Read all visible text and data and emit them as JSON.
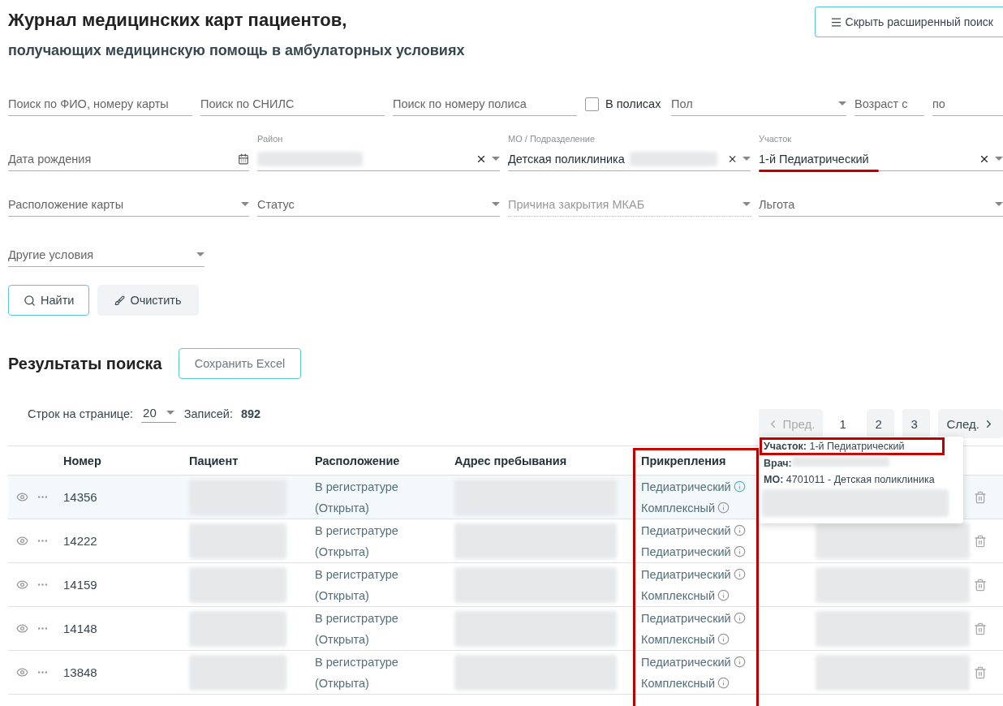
{
  "title": "Журнал медицинских карт пациентов,",
  "subtitle": "получающих медицинскую помощь в амбулаторных условиях",
  "toggle_button": {
    "label": "Скрыть расширенный поиск"
  },
  "filter_rows": [
    {
      "fields": [
        {
          "kind": "text",
          "placeholder": "Поиск по ФИО, номеру карты"
        },
        {
          "kind": "text",
          "placeholder": "Поиск по СНИЛС"
        },
        {
          "kind": "text",
          "placeholder": "Поиск по номеру полиса"
        },
        {
          "kind": "checkbox",
          "label": "В полисах",
          "checked": false
        },
        {
          "kind": "select",
          "placeholder": "Пол"
        },
        {
          "kind": "text",
          "placeholder": "Возраст с"
        },
        {
          "kind": "text",
          "placeholder": "по"
        }
      ]
    },
    {
      "fields": [
        {
          "kind": "date",
          "placeholder": "Дата рождения"
        },
        {
          "kind": "select",
          "label": "Район",
          "blurred": true,
          "clearable": true
        },
        {
          "kind": "select",
          "label": "МО / Подразделение",
          "value": "Детская поликлиника",
          "blurred": true,
          "clearable": true
        },
        {
          "kind": "select",
          "label": "Участок",
          "value": "1-й Педиатрический",
          "clearable": true,
          "highlighted": true
        }
      ]
    },
    {
      "fields": [
        {
          "kind": "select",
          "placeholder": "Расположение карты"
        },
        {
          "kind": "select",
          "placeholder": "Статус"
        },
        {
          "kind": "select",
          "placeholder": "Причина закрытия МКАБ",
          "disabled": true
        },
        {
          "kind": "select",
          "placeholder": "Льгота"
        }
      ]
    },
    {
      "fields": [
        {
          "kind": "select",
          "placeholder": "Другие условия"
        }
      ]
    }
  ],
  "buttons": [
    {
      "kind": "search",
      "label": "Найти"
    },
    {
      "kind": "clear",
      "label": "Очистить"
    }
  ],
  "results": {
    "title": "Результаты поиска",
    "export_button": "Сохранить Excel",
    "rows_per_page_label": "Строк на странице:",
    "rows_per_page": "20",
    "records_label": "Записей:",
    "records": "892"
  },
  "pagination": {
    "prev": {
      "label": "Пред.",
      "disabled": true
    },
    "pages": [
      {
        "label": "1",
        "selected": true
      },
      {
        "label": "2",
        "selected": false
      },
      {
        "label": "3",
        "selected": false
      }
    ],
    "next": {
      "label": "След.",
      "disabled": false
    }
  },
  "table": {
    "columns": [
      "Номер",
      "Пациент",
      "Расположение",
      "Адрес пребывания",
      "Прикрепления"
    ],
    "rows": [
      {
        "number": "14356",
        "location": [
          "В регистратуре",
          "(Открыта)"
        ],
        "attachments": [
          {
            "label": "Педиатрический",
            "active": true
          },
          {
            "label": "Комплексный",
            "active": false
          }
        ],
        "selected": true
      },
      {
        "number": "14222",
        "location": [
          "В регистратуре",
          "(Открыта)"
        ],
        "attachments": [
          {
            "label": "Педиатрический",
            "active": false
          },
          {
            "label": "Педиатрический",
            "active": false
          }
        ],
        "selected": false
      },
      {
        "number": "14159",
        "location": [
          "В регистратуре",
          "(Открыта)"
        ],
        "attachments": [
          {
            "label": "Педиатрический",
            "active": false
          },
          {
            "label": "Комплексный",
            "active": false
          }
        ],
        "selected": false
      },
      {
        "number": "14148",
        "location": [
          "В регистратуре",
          "(Открыта)"
        ],
        "attachments": [
          {
            "label": "Педиатрический",
            "active": false
          },
          {
            "label": "Комплексный",
            "active": false
          }
        ],
        "selected": false
      },
      {
        "number": "13848",
        "location": [
          "В регистратуре",
          "(Открыта)"
        ],
        "attachments": [
          {
            "label": "Педиатрический",
            "active": false
          },
          {
            "label": "Комплексный",
            "active": false
          }
        ],
        "selected": false
      }
    ]
  },
  "tooltip": {
    "lines": [
      {
        "label": "Участок:",
        "value": "1-й Педиатрический",
        "highlighted": true
      },
      {
        "label": "Врач:",
        "blurred": true
      },
      {
        "label": "МО:",
        "value": "4701011 - Детская поликлиника"
      }
    ]
  }
}
